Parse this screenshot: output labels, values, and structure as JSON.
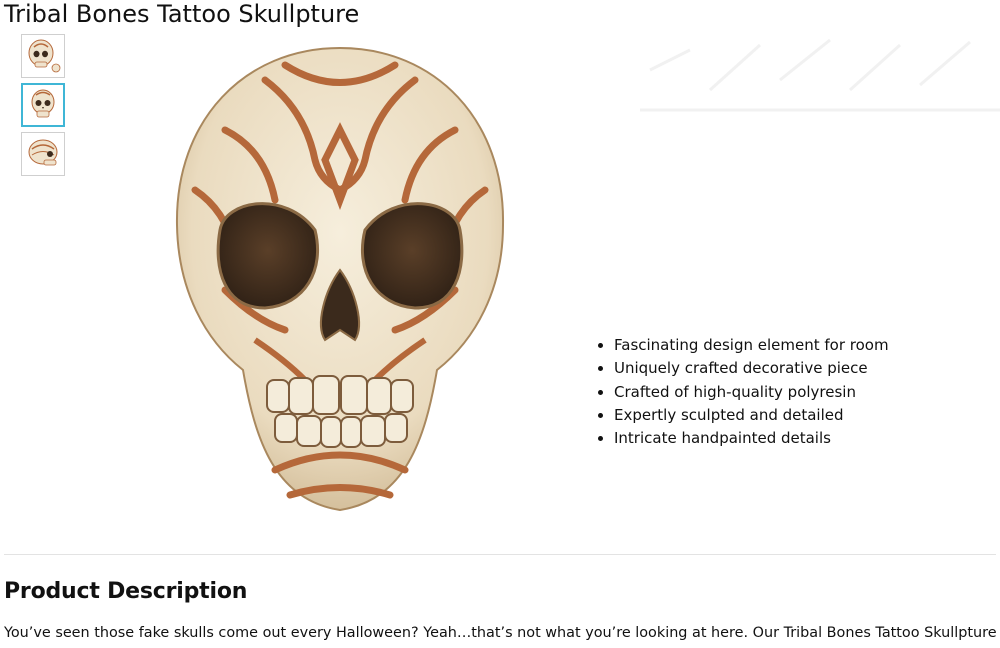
{
  "product": {
    "title": "Tribal Bones Tattoo Skullpture"
  },
  "gallery": {
    "thumbnails": [
      {
        "label": "skull-angle-view",
        "selected": false
      },
      {
        "label": "skull-front-view",
        "selected": true
      },
      {
        "label": "skull-side-view",
        "selected": false
      }
    ],
    "accent_color": "#3fb6d6"
  },
  "features": [
    "Fascinating design element for room",
    "Uniquely crafted decorative piece",
    "Crafted of high-quality polyresin",
    "Expertly sculpted and detailed",
    "Intricate handpainted details"
  ],
  "description": {
    "heading": "Product Description",
    "text": "You’ve seen those fake skulls come out every Halloween? Yeah…that’s not what you’re looking at here. Our Tribal Bones Tattoo Skullpture"
  },
  "colors": {
    "bone": "#efe3cd",
    "tattoo": "#b5683a",
    "shadow": "#3b2a1c"
  }
}
